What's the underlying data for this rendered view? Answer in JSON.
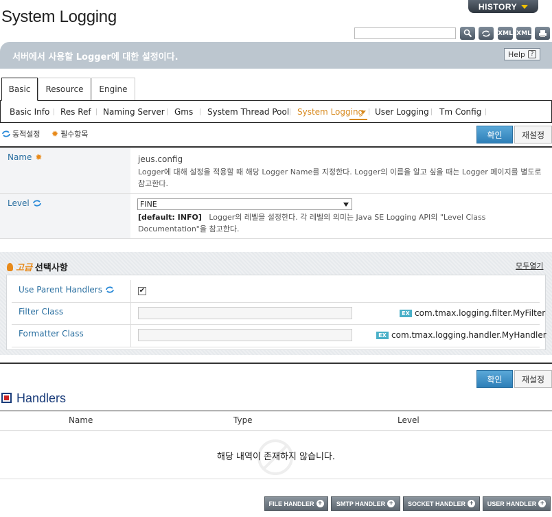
{
  "header": {
    "title": "System Logging",
    "history_label": "HISTORY",
    "search_placeholder": "",
    "toolbar_icons": [
      "search-icon",
      "refresh-icon",
      "xml-export-icon",
      "xml-import-icon",
      "print-icon"
    ],
    "toolbar_icon_text": {
      "xml_export": "XML",
      "xml_import": "XML"
    }
  },
  "description": {
    "text": "서버에서 사용할 Logger에 대한 설정이다.",
    "help_label": "Help"
  },
  "tabs": [
    {
      "label": "Basic",
      "active": true
    },
    {
      "label": "Resource",
      "active": false
    },
    {
      "label": "Engine",
      "active": false
    }
  ],
  "subnav": [
    {
      "label": "Basic Info",
      "active": false
    },
    {
      "label": "Res Ref",
      "active": false
    },
    {
      "label": "Naming Server",
      "active": false
    },
    {
      "label": "Gms",
      "active": false
    },
    {
      "label": "System Thread Pool",
      "active": false
    },
    {
      "label": "System Logging",
      "active": true
    },
    {
      "label": "User Logging",
      "active": false
    },
    {
      "label": "Tm Config",
      "active": false
    }
  ],
  "legend": {
    "dynamic": "동적설정",
    "required": "필수항목"
  },
  "actions": {
    "confirm": "확인",
    "reset": "재설정"
  },
  "form": {
    "name": {
      "label": "Name",
      "value": "jeus.config",
      "help": "Logger에 대해 설정을 적용할 때 해당 Logger Name를 지정한다. Logger의 이름을 알고 싶을 때는 Logger 페이지를 별도로 참고한다."
    },
    "level": {
      "label": "Level",
      "selected": "FINE",
      "default_tag": "[default: INFO]",
      "help": "Logger의 레벨을 설정한다. 각 레벨의 의미는 Java SE Logging API의 \"Level Class Documentation\"을 참고한다."
    }
  },
  "advanced": {
    "title_keyword": "고급",
    "title_rest": "선택사항",
    "expand_all": "모두열기",
    "use_parent_handlers": {
      "label": "Use Parent Handlers",
      "checked": true,
      "check_mark": "✔"
    },
    "filter_class": {
      "label": "Filter Class",
      "value": "",
      "example_badge": "EX",
      "example": "com.tmax.logging.filter.MyFilter"
    },
    "formatter_class": {
      "label": "Formatter Class",
      "value": "",
      "example_badge": "EX",
      "example": "com.tmax.logging.handler.MyHandler"
    }
  },
  "handlers": {
    "title": "Handlers",
    "columns": [
      "Name",
      "Type",
      "Level"
    ],
    "empty_message": "해당 내역이 존재하지 않습니다.",
    "buttons": [
      "FILE HANDLER",
      "SMTP HANDLER",
      "SOCKET HANDLER",
      "USER HANDLER"
    ]
  },
  "colors": {
    "accent": "#2a6fa0",
    "active_tab": "#d88a1f",
    "required": "#e88a1a"
  }
}
